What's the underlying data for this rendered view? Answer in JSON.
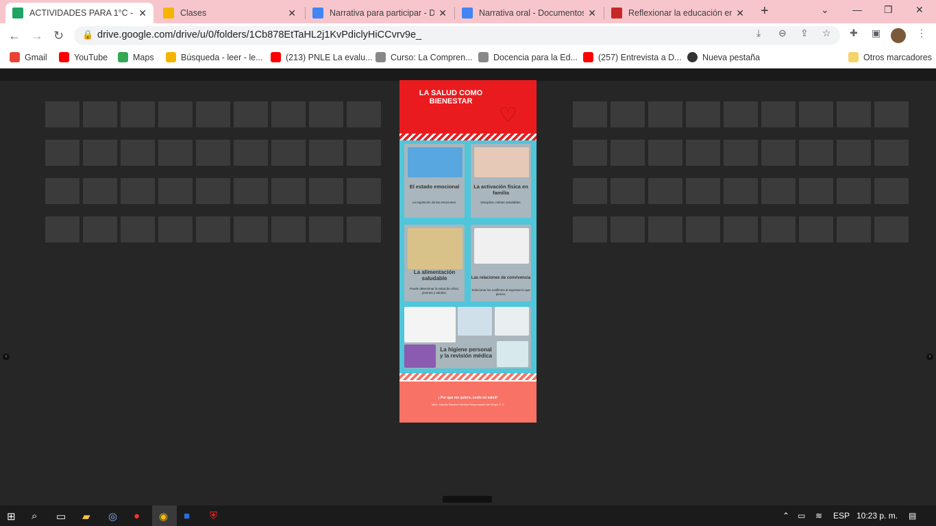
{
  "browser": {
    "tabs": [
      {
        "title": "ACTIVIDADES PARA 1°C - Go",
        "favicon": "google-drive-icon",
        "color": "#1fa463",
        "active": true
      },
      {
        "title": "Clases",
        "favicon": "google-classroom-icon",
        "color": "#f4b400",
        "active": false
      },
      {
        "title": "Narrativa para participar - Do",
        "favicon": "google-docs-icon",
        "color": "#4285f4",
        "active": false
      },
      {
        "title": "Narrativa oral - Documentos",
        "favicon": "google-docs-icon",
        "color": "#4285f4",
        "active": false
      },
      {
        "title": "Reflexionar la educación en n",
        "favicon": "e-icon",
        "color": "#c62828",
        "active": false
      }
    ],
    "url": "drive.google.com/drive/u/0/folders/1Cb878EtTaHL2j1KvPdiclyHiCCvrv9e_",
    "bookmarks": [
      {
        "label": "Gmail",
        "icon": "gmail-icon",
        "color": "#ea4335"
      },
      {
        "label": "YouTube",
        "icon": "youtube-icon",
        "color": "#ff0000"
      },
      {
        "label": "Maps",
        "icon": "maps-icon",
        "color": "#34a853"
      },
      {
        "label": "Búsqueda - leer - le...",
        "icon": "lp-icon",
        "color": "#f4b400"
      },
      {
        "label": "(213) PNLE La evalu...",
        "icon": "youtube-icon",
        "color": "#ff0000"
      },
      {
        "label": "Curso: La Compren...",
        "icon": "course-icon",
        "color": "#888888"
      },
      {
        "label": "Docencia para la Ed...",
        "icon": "course-icon",
        "color": "#888888"
      },
      {
        "label": "(257) Entrevista a D...",
        "icon": "youtube-icon",
        "color": "#ff0000"
      },
      {
        "label": "Nueva pestaña",
        "icon": "globe-icon",
        "color": "#333333"
      }
    ],
    "other_bookmarks": "Otros marcadores"
  },
  "document": {
    "title": "LA SALUD COMO BIENESTAR",
    "cards": [
      {
        "title": "El estado emocional",
        "subtitle": "La regulación  de las emociones."
      },
      {
        "title": "La activación física en familia",
        "subtitle": "Disciplina, rutinas saludables."
      },
      {
        "title": "La alimentación saludable",
        "subtitle": "Puede determinar la salud  de niños, jóvenes y adultos."
      },
      {
        "title": "Las relaciones de convivencia",
        "subtitle": "Solucionar los conflictos al expresar lo que pienso."
      },
      {
        "title": "La higiene personal y la revisión médica",
        "subtitle": ""
      }
    ],
    "slogan": "¡ Por que me quiero, cuido mi salud!",
    "author": "Mtra. Claudia Ramirez Medina Responsable del Grupo 1° C",
    "colors": {
      "header": "#ea1b1e",
      "body": "#4fc6da",
      "footer": "#f87265"
    }
  },
  "taskbar": {
    "language": "ESP",
    "time": "10:23 p. m."
  }
}
